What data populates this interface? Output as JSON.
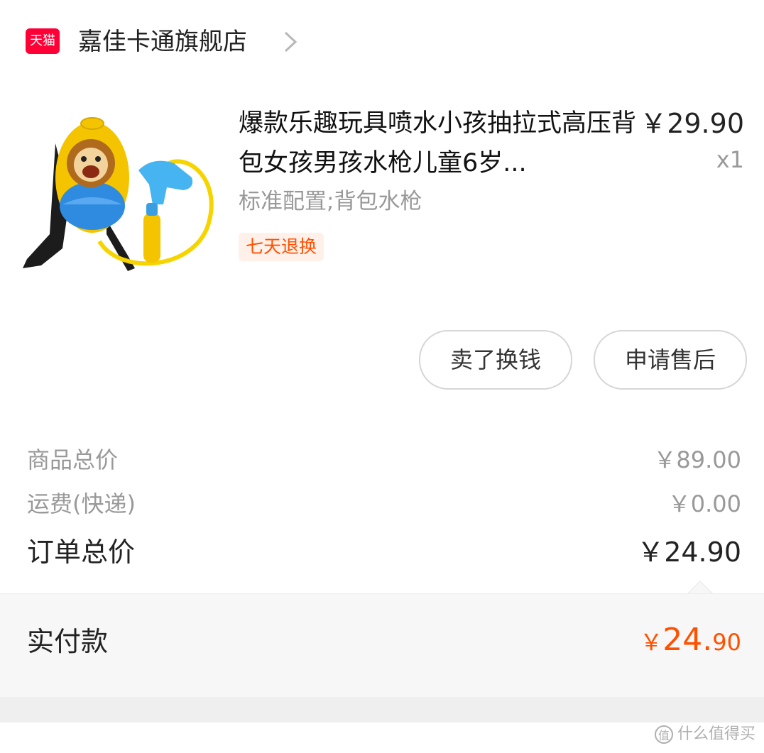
{
  "store": {
    "badge": "天猫",
    "name": "嘉佳卡通旗舰店",
    "chevron_icon": "chevron-right-icon"
  },
  "product": {
    "title": "爆款乐趣玩具喷水小孩抽拉式高压背包女孩男孩水枪儿童6岁...",
    "price": "￥29.90",
    "quantity": "x1",
    "spec": "标准配置;背包水枪",
    "service_tag": "七天退换",
    "image_icon": "water-gun-backpack-image"
  },
  "actions": {
    "sell": "卖了换钱",
    "after_sale": "申请售后"
  },
  "summary": {
    "goods_total_label": "商品总价",
    "goods_total_value": "￥89.00",
    "shipping_label": "运费(快递)",
    "shipping_value": "￥0.00",
    "order_total_label": "订单总价",
    "order_total_value": "￥24.90"
  },
  "paid": {
    "label": "实付款",
    "symbol": "￥",
    "integer": "24.",
    "decimal": "90"
  },
  "watermark": {
    "logo": "值",
    "text": "什么值得买"
  },
  "colors": {
    "accent": "#ff5000",
    "tmall": "#ff0036"
  }
}
